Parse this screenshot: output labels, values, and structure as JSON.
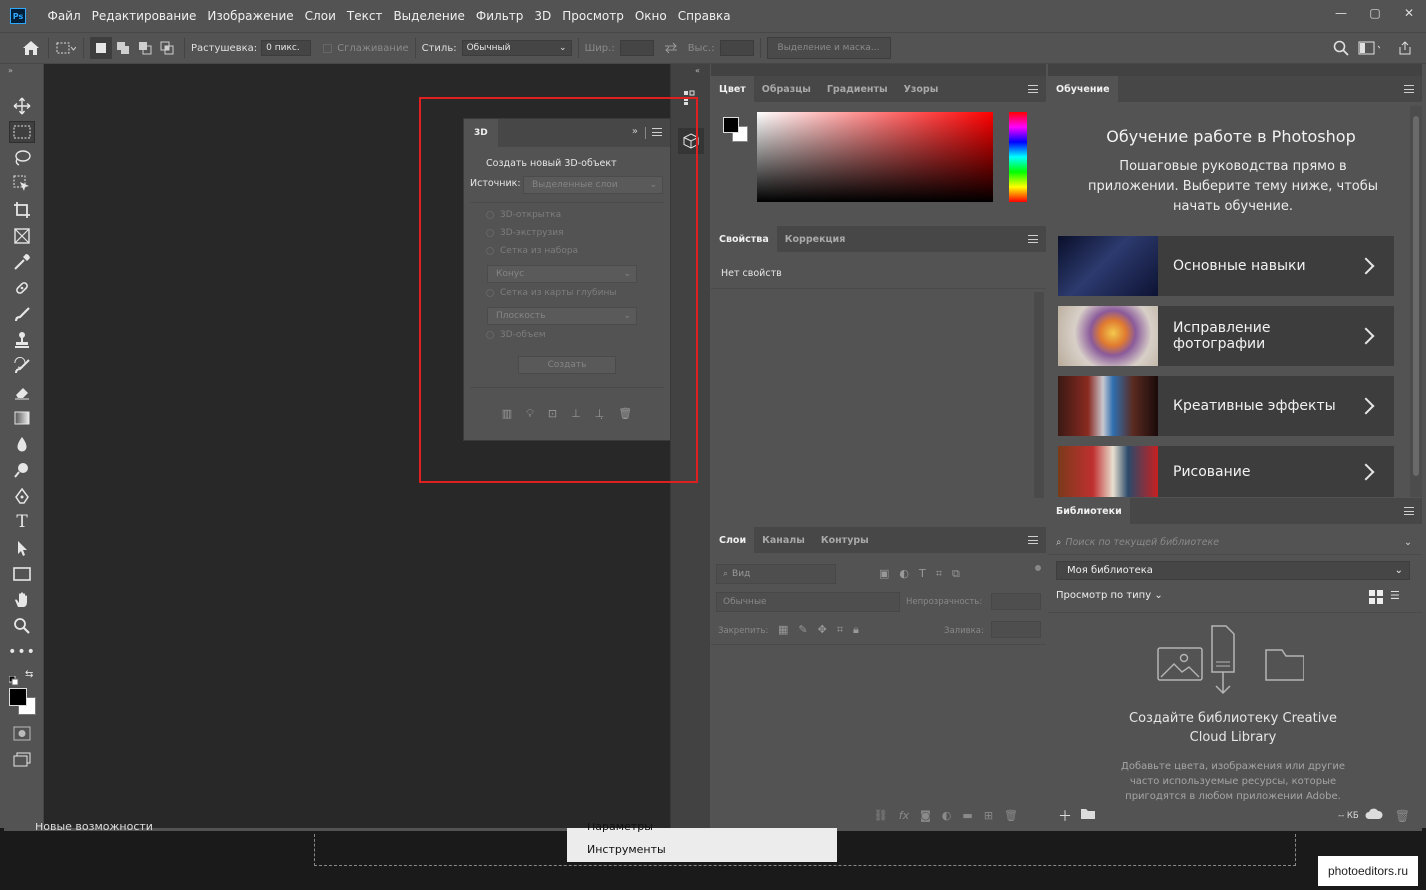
{
  "app": {
    "logo": "Ps"
  },
  "menu": [
    "Файл",
    "Редактирование",
    "Изображение",
    "Слои",
    "Текст",
    "Выделение",
    "Фильтр",
    "3D",
    "Просмотр",
    "Окно",
    "Справка"
  ],
  "window_controls": {
    "minimize": "—",
    "restore": "▢",
    "close": "✕"
  },
  "options": {
    "feather_label": "Растушевка:",
    "feather_value": "0 пикс.",
    "antialias_label": "Сглаживание",
    "style_label": "Стиль:",
    "style_value": "Обычный",
    "width_label": "Шир.:",
    "height_label": "Выс.:",
    "select_mask_button": "Выделение и маска..."
  },
  "panel3d": {
    "tab": "3D",
    "section_title": "Создать новый 3D-объект",
    "source_label": "Источник:",
    "source_value": "Выделенные слои",
    "options": [
      "3D-открытка",
      "3D-экструзия",
      "Сетка из набора",
      "Сетка из карты глубины",
      "3D-объем"
    ],
    "preset_mesh": "Конус",
    "depth_mesh": "Плоскость",
    "create_button": "Создать"
  },
  "color_panel": {
    "tabs": [
      "Цвет",
      "Образцы",
      "Градиенты",
      "Узоры"
    ],
    "foreground": "#000000",
    "background": "#ffffff"
  },
  "properties_panel": {
    "tabs": [
      "Свойства",
      "Коррекция"
    ],
    "empty_text": "Нет свойств"
  },
  "layers_panel": {
    "tabs": [
      "Слои",
      "Каналы",
      "Контуры"
    ],
    "filter_placeholder": "Вид",
    "blend_mode": "Обычные",
    "opacity_label": "Непрозрачность:",
    "lock_label": "Закрепить:",
    "fill_label": "Заливка:"
  },
  "learn_panel": {
    "tab": "Обучение",
    "title": "Обучение работе в Photoshop",
    "subtitle": "Пошаговые руководства прямо в приложении. Выберите тему ниже, чтобы начать обучение.",
    "cards": [
      "Основные навыки",
      "Исправление фотографии",
      "Креативные эффекты",
      "Рисование"
    ]
  },
  "libraries_panel": {
    "tab": "Библиотеки",
    "search_placeholder": "Поиск по текущей библиотеке",
    "library_name": "Моя библиотека",
    "view_by": "Просмотр по типу",
    "empty_title": "Создайте библиотеку Creative Cloud Library",
    "empty_text": "Добавьте цвета, изображения или другие часто используемые ресурсы, которые пригодятся в любом приложении Adobe.",
    "size": "-- КБ"
  },
  "bottom": {
    "partial_text": "Новые возможности",
    "menu_items": [
      "Параметры",
      "Инструменты"
    ]
  },
  "watermark": "photoeditors.ru"
}
